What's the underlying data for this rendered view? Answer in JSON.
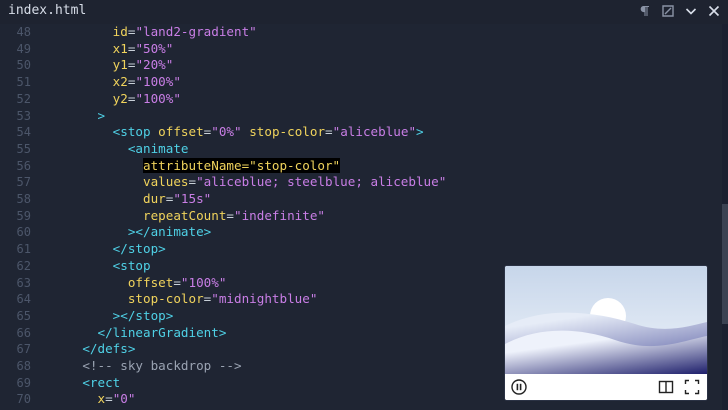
{
  "window": {
    "title": "index.html",
    "icons": [
      "paragraph-icon",
      "tag-icon",
      "chevron-down-icon",
      "close-icon"
    ]
  },
  "editor": {
    "lines": [
      {
        "n": "48",
        "indent": "        ",
        "parts": [
          {
            "k": "a",
            "t": "id"
          },
          {
            "k": "eq",
            "t": "="
          },
          {
            "k": "s",
            "t": "\"land2-gradient\""
          }
        ]
      },
      {
        "n": "49",
        "indent": "        ",
        "parts": [
          {
            "k": "a",
            "t": "x1"
          },
          {
            "k": "eq",
            "t": "="
          },
          {
            "k": "s",
            "t": "\"50%\""
          }
        ]
      },
      {
        "n": "50",
        "indent": "        ",
        "parts": [
          {
            "k": "a",
            "t": "y1"
          },
          {
            "k": "eq",
            "t": "="
          },
          {
            "k": "s",
            "t": "\"20%\""
          }
        ]
      },
      {
        "n": "51",
        "indent": "        ",
        "parts": [
          {
            "k": "a",
            "t": "x2"
          },
          {
            "k": "eq",
            "t": "="
          },
          {
            "k": "s",
            "t": "\"100%\""
          }
        ]
      },
      {
        "n": "52",
        "indent": "        ",
        "parts": [
          {
            "k": "a",
            "t": "y2"
          },
          {
            "k": "eq",
            "t": "="
          },
          {
            "k": "s",
            "t": "\"100%\""
          }
        ]
      },
      {
        "n": "53",
        "indent": "      ",
        "parts": [
          {
            "k": "t",
            "t": ">"
          }
        ]
      },
      {
        "n": "54",
        "indent": "        ",
        "parts": [
          {
            "k": "t",
            "t": "<stop "
          },
          {
            "k": "a",
            "t": "offset"
          },
          {
            "k": "eq",
            "t": "="
          },
          {
            "k": "s",
            "t": "\"0%\""
          },
          {
            "k": "eq",
            "t": " "
          },
          {
            "k": "a",
            "t": "stop-color"
          },
          {
            "k": "eq",
            "t": "="
          },
          {
            "k": "s",
            "t": "\"aliceblue\""
          },
          {
            "k": "t",
            "t": ">"
          }
        ]
      },
      {
        "n": "55",
        "indent": "          ",
        "parts": [
          {
            "k": "t",
            "t": "<animate"
          }
        ]
      },
      {
        "n": "56",
        "indent": "            ",
        "parts": [
          {
            "k": "hl",
            "t": "attributeName=\"stop-color\""
          }
        ]
      },
      {
        "n": "57",
        "indent": "            ",
        "parts": [
          {
            "k": "a",
            "t": "values"
          },
          {
            "k": "eq",
            "t": "="
          },
          {
            "k": "s",
            "t": "\"aliceblue; steelblue; aliceblue\""
          }
        ]
      },
      {
        "n": "58",
        "indent": "            ",
        "parts": [
          {
            "k": "a",
            "t": "dur"
          },
          {
            "k": "eq",
            "t": "="
          },
          {
            "k": "s",
            "t": "\"15s\""
          }
        ]
      },
      {
        "n": "59",
        "indent": "            ",
        "parts": [
          {
            "k": "a",
            "t": "repeatCount"
          },
          {
            "k": "eq",
            "t": "="
          },
          {
            "k": "s",
            "t": "\"indefinite\""
          }
        ]
      },
      {
        "n": "60",
        "indent": "          ",
        "parts": [
          {
            "k": "t",
            "t": "></animate>"
          }
        ]
      },
      {
        "n": "61",
        "indent": "        ",
        "parts": [
          {
            "k": "t",
            "t": "</stop>"
          }
        ]
      },
      {
        "n": "62",
        "indent": "        ",
        "parts": [
          {
            "k": "t",
            "t": "<stop"
          }
        ]
      },
      {
        "n": "63",
        "indent": "          ",
        "parts": [
          {
            "k": "a",
            "t": "offset"
          },
          {
            "k": "eq",
            "t": "="
          },
          {
            "k": "s",
            "t": "\"100%\""
          }
        ]
      },
      {
        "n": "64",
        "indent": "          ",
        "parts": [
          {
            "k": "a",
            "t": "stop-color"
          },
          {
            "k": "eq",
            "t": "="
          },
          {
            "k": "s",
            "t": "\"midnightblue\""
          }
        ]
      },
      {
        "n": "65",
        "indent": "        ",
        "parts": [
          {
            "k": "t",
            "t": "></stop>"
          }
        ]
      },
      {
        "n": "66",
        "indent": "      ",
        "parts": [
          {
            "k": "t",
            "t": "</linearGradient>"
          }
        ]
      },
      {
        "n": "67",
        "indent": "    ",
        "parts": [
          {
            "k": "t",
            "t": "</defs>"
          }
        ]
      },
      {
        "n": "68",
        "indent": "    ",
        "parts": [
          {
            "k": "c",
            "t": "<!-- sky backdrop -->"
          }
        ]
      },
      {
        "n": "69",
        "indent": "    ",
        "parts": [
          {
            "k": "t",
            "t": "<rect"
          }
        ]
      },
      {
        "n": "70",
        "indent": "      ",
        "parts": [
          {
            "k": "a",
            "t": "x"
          },
          {
            "k": "eq",
            "t": "="
          },
          {
            "k": "s",
            "t": "\"0\""
          }
        ]
      }
    ]
  },
  "pip": {
    "controls": [
      "pause-icon",
      "split-view-icon",
      "fullscreen-icon"
    ]
  },
  "colors": {
    "background": "#1f2533",
    "tag": "#4fd1e6",
    "attribute": "#f0d35c",
    "string": "#c97ee6",
    "comment": "#9aa3b2",
    "line_number": "#4c566a"
  }
}
